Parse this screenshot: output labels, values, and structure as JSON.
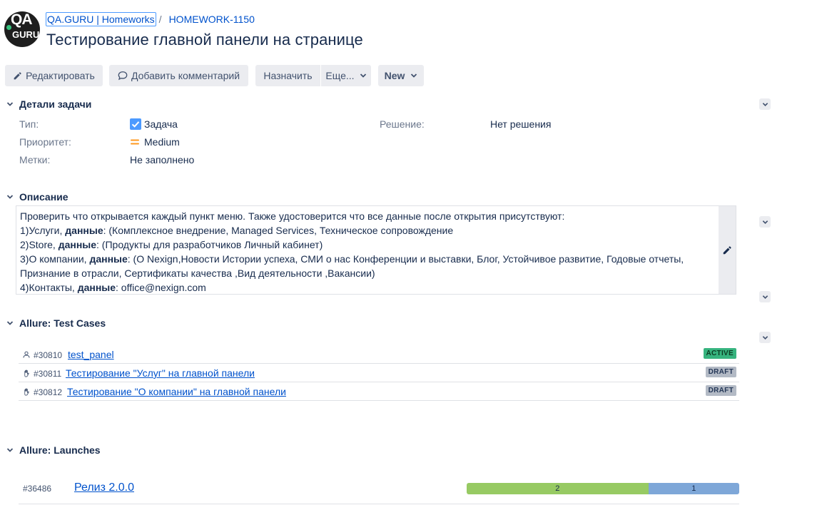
{
  "header": {
    "logo_top": "QA",
    "logo_bottom": "GURU",
    "breadcrumb_project": "QA.GURU | Homeworks",
    "breadcrumb_separator": "/",
    "breadcrumb_issue": "HOMEWORK-1150",
    "title": "Тестирование главной панели на странице"
  },
  "toolbar": {
    "edit_label": "Редактировать",
    "comment_label": "Добавить комментарий",
    "assign_label": "Назначить",
    "more_label": "Еще...",
    "status_label": "New"
  },
  "details": {
    "title": "Детали задачи",
    "type_label": "Тип:",
    "type_value": "Задача",
    "priority_label": "Приоритет:",
    "priority_value": "Medium",
    "labels_label": "Метки:",
    "labels_value": "Не заполнено",
    "resolution_label": "Решение:",
    "resolution_value": "Нет решения"
  },
  "description": {
    "title": "Описание",
    "line1": "Проверить что открывается каждый пункт меню. Также удостоверится что все данные после открытия присутствуют:",
    "l2_pre": "1)Услуги, ",
    "l2_bold": "данные",
    "l2_post": ": (Комплексное внедрение, Managed Services, Техническое сопровождение",
    "l3_pre": "2)Store, ",
    "l3_bold": "данные",
    "l3_post": ": (Продукты для разработчиков Личный кабинет)",
    "l4_pre": "3)О компании, ",
    "l4_bold": "данные",
    "l4_post": ": (О Nexign,Новости Истории успеха, СМИ о нас Конференции и выставки, Блог, Устойчивое развитие, Годовые отчеты,",
    "line5": "Признание в отрасли, Сертификаты качества ,Вид деятельности ,Вакансии)",
    "l6_pre": "4)Контакты, ",
    "l6_bold": "данные",
    "l6_post": ": office@nexign.com"
  },
  "test_cases": {
    "title": "Allure: Test Cases",
    "rows": [
      {
        "id": "#30810",
        "name": "test_panel",
        "status": "ACTIVE",
        "kind": "automated"
      },
      {
        "id": "#30811",
        "name": "Тестирование \"Услуг\" на главной панели",
        "status": "DRAFT",
        "kind": "manual"
      },
      {
        "id": "#30812",
        "name": "Тестирование \"О компании\" на главной панели",
        "status": "DRAFT",
        "kind": "manual"
      }
    ]
  },
  "launches": {
    "title": "Allure: Launches",
    "rows": [
      {
        "id": "#36486",
        "name": "Релиз 2.0.0",
        "passed": 2,
        "unknown": 1
      }
    ]
  },
  "colors": {
    "link": "#0052cc",
    "active_badge": "#36b37e",
    "draft_badge": "#b3bac5",
    "passed": "#97ca63",
    "unknown": "#7ea7d8",
    "priority_medium": "#ff991f",
    "type_task": "#4c9aff"
  }
}
